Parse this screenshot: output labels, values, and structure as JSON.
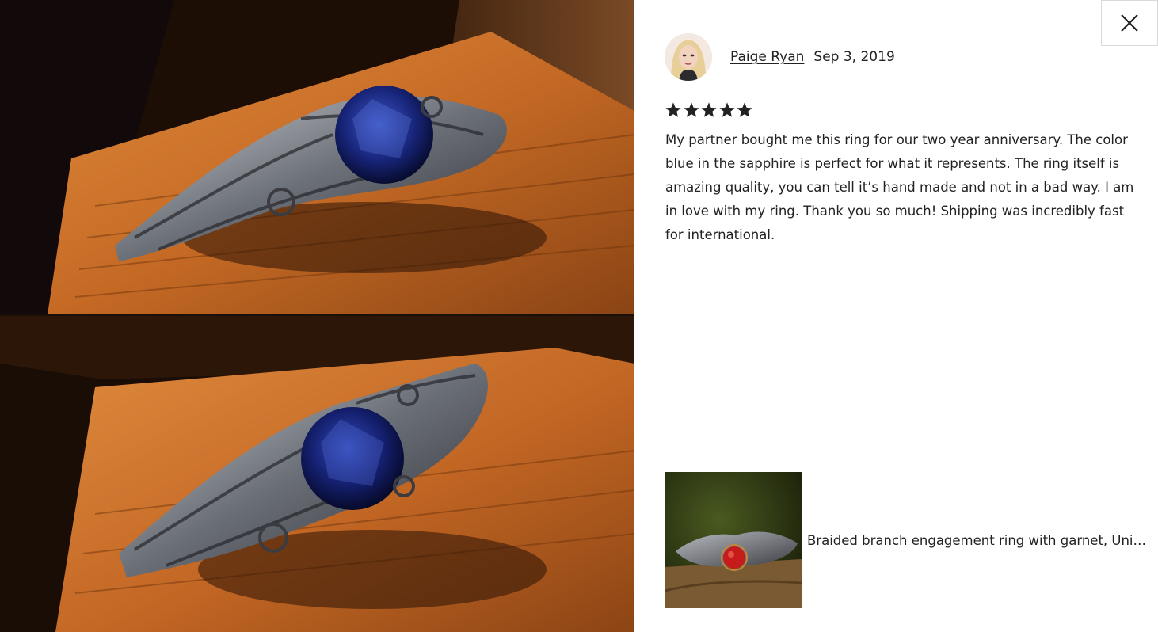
{
  "modal": {
    "close_icon": "close-icon"
  },
  "review": {
    "reviewer_name": "Paige Ryan",
    "date": "Sep 3, 2019",
    "rating": 5,
    "rating_max": 5,
    "text": "My partner bought me this ring for our two year anniversary. The color blue in the sapphire is perfect for what it represents. The ring itself is amazing quality, you can tell it’s hand made and not in a bad way. I am in love with my ring. Thank you so much! Shipping was incredibly fast for international."
  },
  "product": {
    "title": "Braided branch engagement ring with garnet, Unique twig engagement ring"
  },
  "colors": {
    "text": "#222222",
    "star": "#222222",
    "border": "#d9d9d9"
  }
}
